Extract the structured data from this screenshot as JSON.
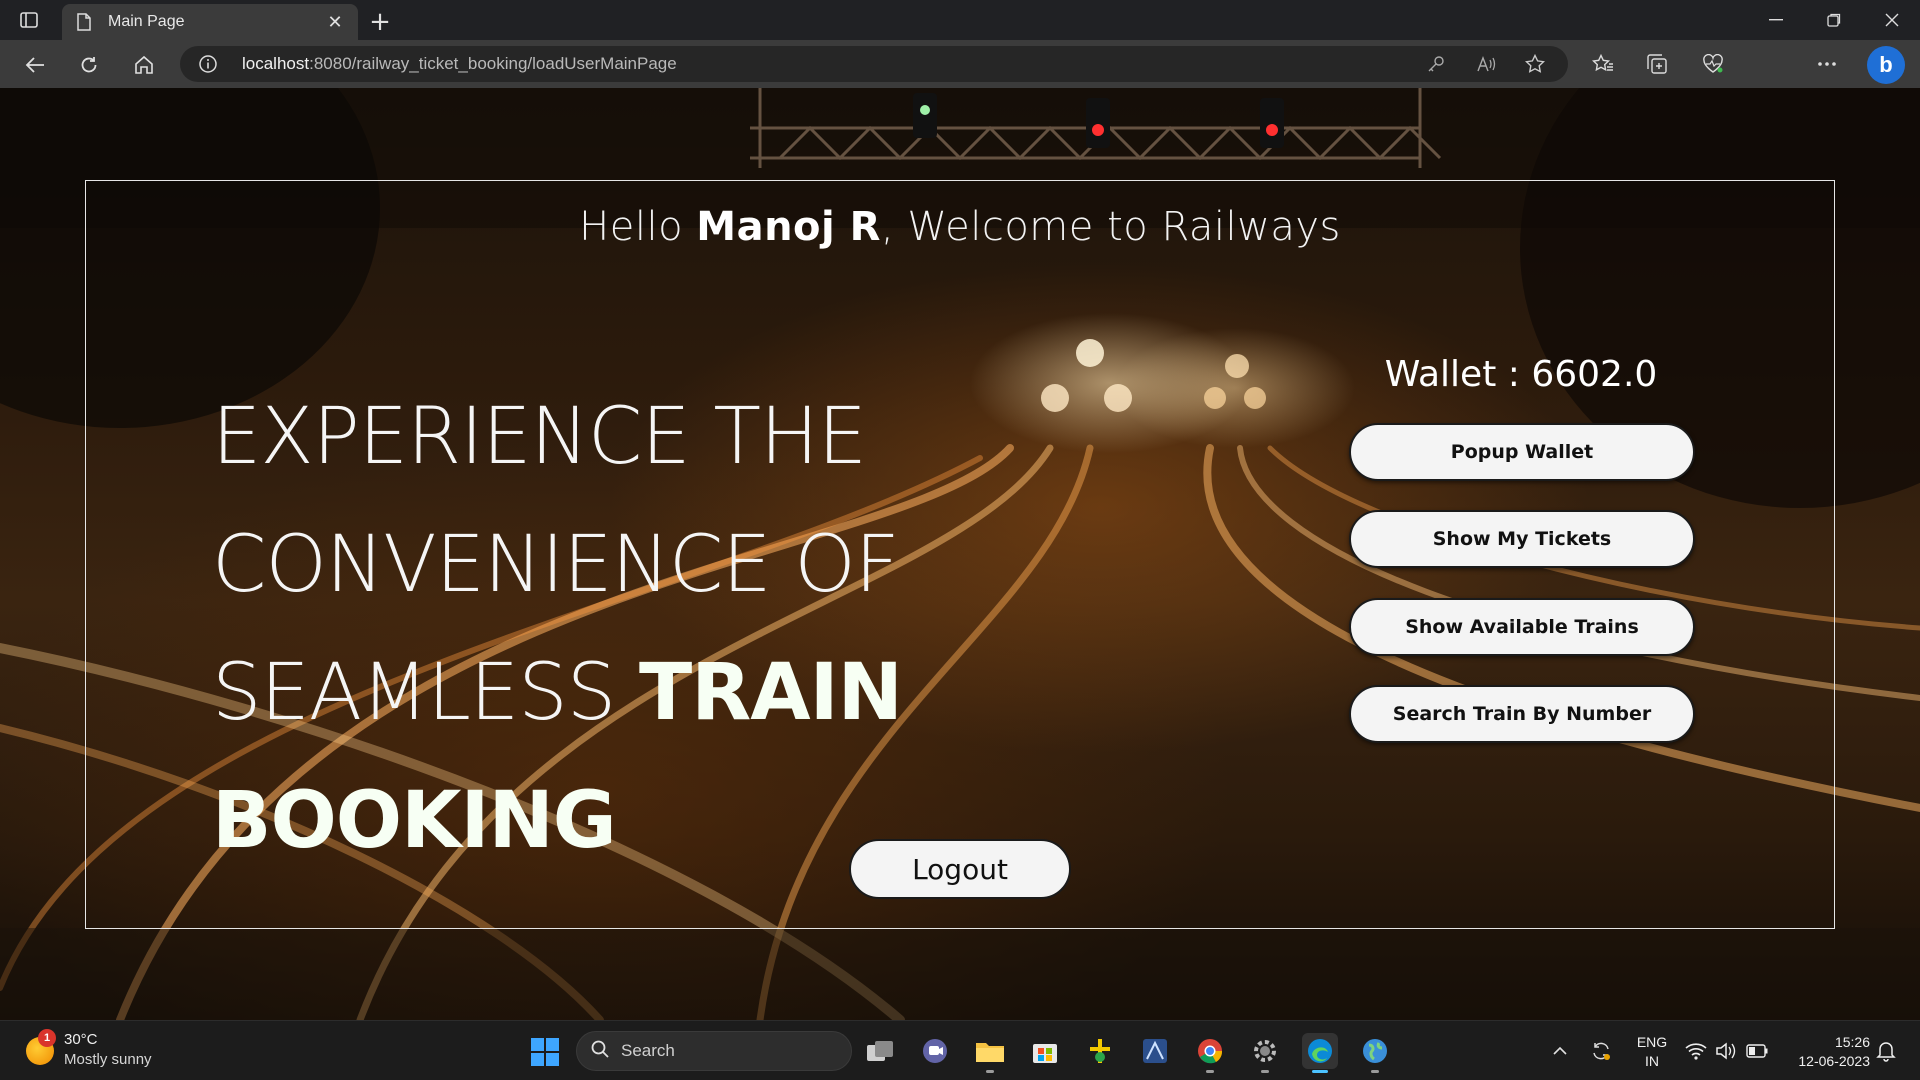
{
  "browser": {
    "tab_title": "Main Page",
    "url_host": "localhost",
    "url_rest": ":8080/railway_ticket_booking/loadUserMainPage"
  },
  "page": {
    "greeting_prefix": "Hello ",
    "user_name": "Manoj R",
    "greeting_suffix": ", Welcome to Railways",
    "hero_line1": "EXPERIENCE THE",
    "hero_line2": "CONVENIENCE OF",
    "hero_line3_light": "SEAMLESS ",
    "hero_line3_bold": "TRAIN BOOKING",
    "wallet_label": "Wallet : 6602.0",
    "buttons": [
      {
        "label": "Popup Wallet"
      },
      {
        "label": "Show My Tickets"
      },
      {
        "label": "Show Available Trains"
      },
      {
        "label": "Search Train By Number"
      }
    ],
    "logout_label": "Logout"
  },
  "taskbar": {
    "weather_temp": "30°C",
    "weather_desc": "Mostly sunny",
    "weather_badge": "1",
    "search_label": "Search",
    "lang_line1": "ENG",
    "lang_line2": "IN",
    "time": "15:26",
    "date": "12-06-2023"
  },
  "colors": {
    "panel_border": "#e6e6e6",
    "button_bg": "#f4f4f4",
    "active_app_indicator": "#4cc2ff",
    "bing_blue": "#1f6fd6"
  },
  "icons": [
    "tab-toggle-icon",
    "document-icon",
    "close-icon",
    "plus-icon",
    "minimize-icon",
    "maximize-icon",
    "window-close-icon",
    "back-icon",
    "refresh-icon",
    "home-icon",
    "info-icon",
    "key-icon",
    "read-aloud-icon",
    "star-icon",
    "favorites-icon",
    "collections-icon",
    "heart-icon",
    "more-icon",
    "bing-icon",
    "windows-start-icon",
    "search-icon",
    "task-view-icon",
    "teams-icon",
    "file-explorer-icon",
    "store-icon",
    "app-icon",
    "app-icon",
    "chrome-icon",
    "settings-icon",
    "edge-icon",
    "globe-icon",
    "chevron-up-icon",
    "sync-icon",
    "wifi-icon",
    "volume-icon",
    "battery-icon",
    "notification-icon"
  ]
}
